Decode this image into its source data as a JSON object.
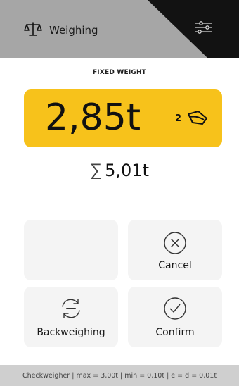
{
  "header": {
    "title": "Weighing",
    "icon": "balance-scale-icon",
    "settings_icon": "sliders-icon",
    "bg_color": "#a6a6a6",
    "wedge_color": "#121212"
  },
  "main": {
    "mode_label": "FIXED WEIGHT",
    "weight": {
      "value": "2,85t",
      "count": "2",
      "icon": "bucket-load-icon",
      "bg_color": "#f7c21b"
    },
    "total": {
      "icon": "sigma-icon",
      "symbol": "∑",
      "value": "5,01t"
    }
  },
  "buttons": {
    "empty_label": "",
    "cancel": {
      "label": "Cancel",
      "icon": "cancel-circle-icon"
    },
    "backweighing": {
      "label": "Backweighing",
      "icon": "backweighing-icon"
    },
    "confirm": {
      "label": "Confirm",
      "icon": "confirm-check-icon"
    }
  },
  "footer": {
    "text": "Checkweigher | max = 3,00t | min = 0,10t | e = d = 0,01t"
  }
}
